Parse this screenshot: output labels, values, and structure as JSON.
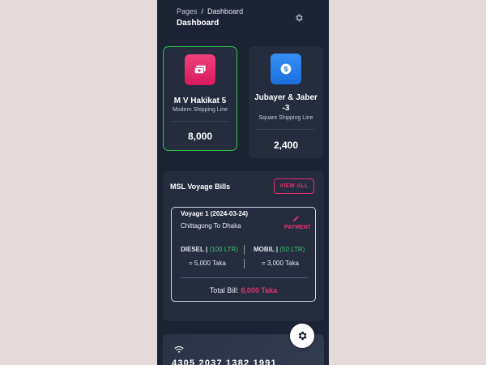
{
  "breadcrumb": {
    "parent": "Pages",
    "separator": "/",
    "current": "Dashboard"
  },
  "page_title": "Dashboard",
  "ships": [
    {
      "name": "M V Hakikat 5",
      "company": "Modern Shipping Line",
      "value": "8,000",
      "icon": "money-icon",
      "accent": "#e91e63",
      "selected": true
    },
    {
      "name": "Jubayer & Jaber -3",
      "company": "Square Shipping Line",
      "value": "2,400",
      "icon": "dollar-icon",
      "accent": "#2f80ed",
      "selected": false
    }
  ],
  "bills": {
    "title": "MSL Voyage Bills",
    "view_all_label": "VIEW ALL",
    "voyage": {
      "title": "Voyage 1 (2024-03-24)",
      "route": "Chittagong To Dhaka",
      "payment_label": "PAYMENT",
      "diesel_label": "DIESEL |",
      "diesel_qty": "(100 LTR)",
      "diesel_amount": "= 5,000 Taka",
      "mobil_label": "MOBIL |",
      "mobil_qty": "(50 LTR)",
      "mobil_amount": "= 3,000 Taka",
      "total_label": "Total Bill:",
      "total_amount": "8,000 Taka"
    }
  },
  "bank_card": {
    "number": "4305 2037 1382 1991"
  },
  "colors": {
    "accent_pink": "#e0336f",
    "success_green": "#2fc545",
    "qty_green": "#3fc36b",
    "panel": "#242c3e",
    "background": "#1c2334"
  }
}
